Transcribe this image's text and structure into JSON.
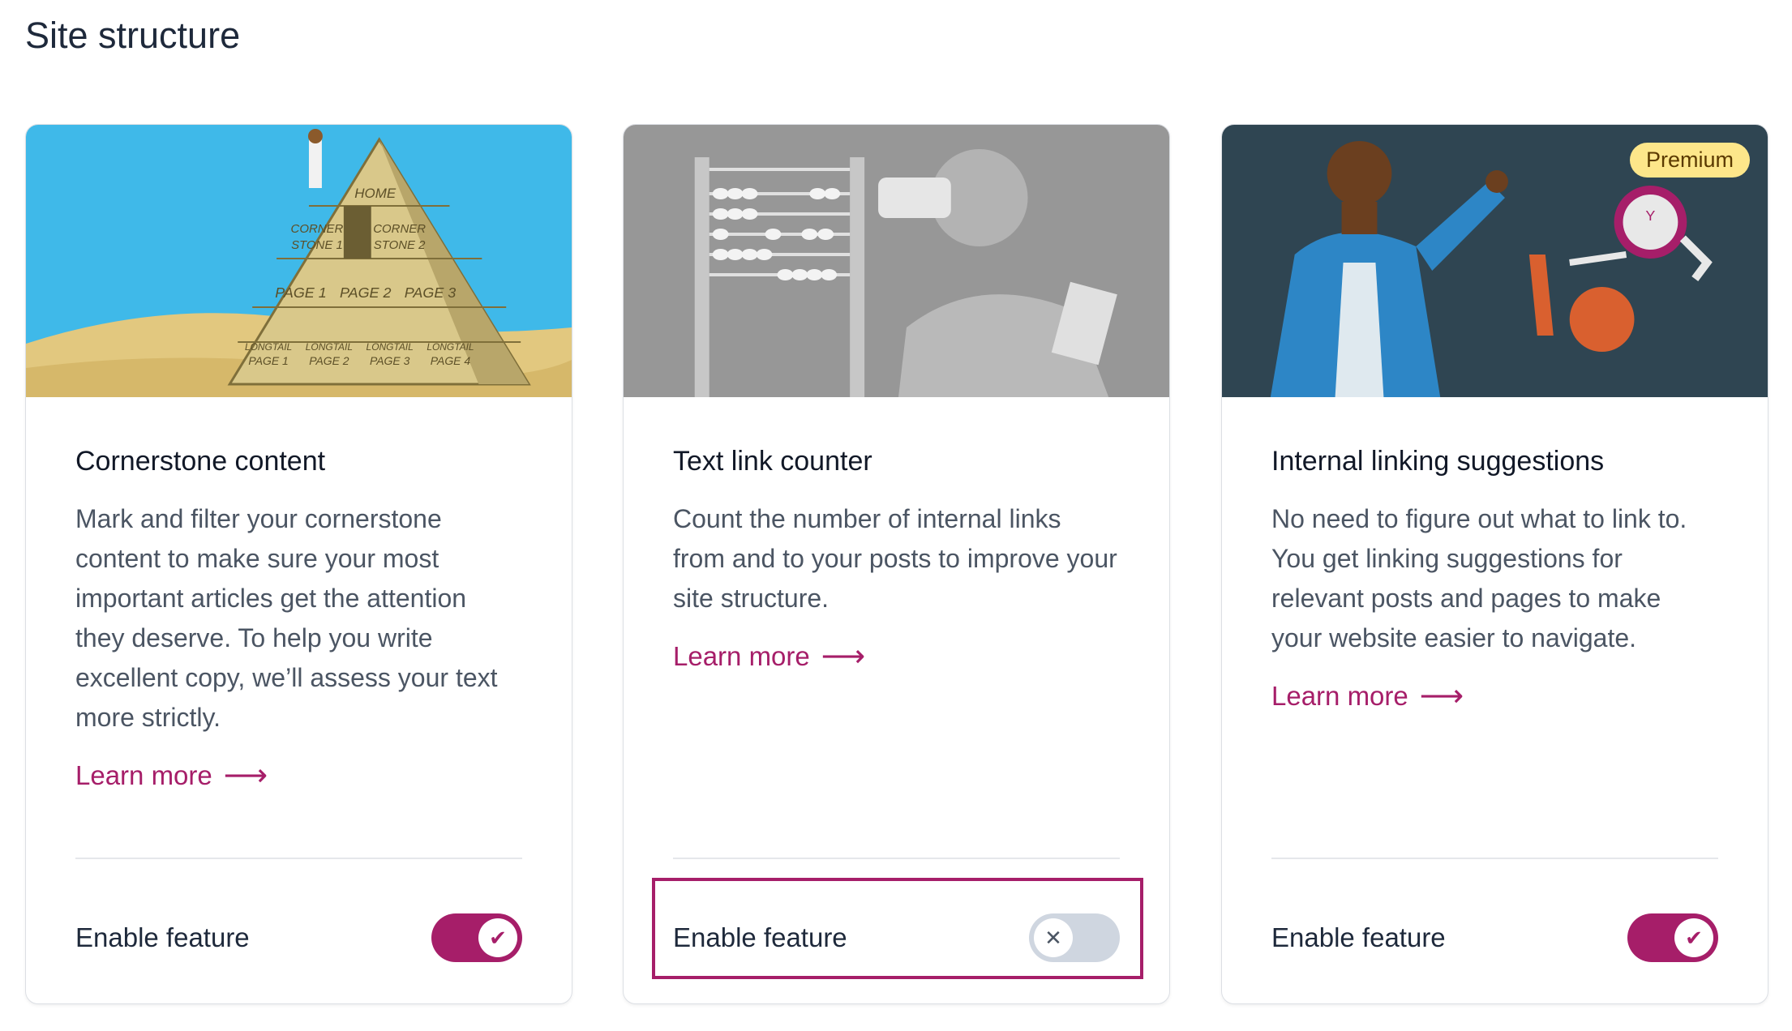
{
  "page": {
    "title": "Site structure"
  },
  "cards": [
    {
      "title": "Cornerstone content",
      "description": "Mark and filter your cornerstone content to make sure your most important articles get the attention they deserve. To help you write excellent copy, we’ll assess your text more strictly.",
      "learn_more": "Learn more",
      "toggle_label": "Enable feature",
      "enabled": true,
      "image_text": {
        "home": "HOME",
        "cs1a": "CORNER",
        "cs1b": "STONE 1",
        "cs2a": "CORNER",
        "cs2b": "STONE 2",
        "p1": "PAGE 1",
        "p2": "PAGE 2",
        "p3": "PAGE 3",
        "lt": "LONGTAIL",
        "lp1": "PAGE 1",
        "lp2": "PAGE 2",
        "lp3": "PAGE 3",
        "lp4": "PAGE 4"
      }
    },
    {
      "title": "Text link counter",
      "description": "Count the number of internal links from and to your posts to improve your site structure.",
      "learn_more": "Learn more",
      "toggle_label": "Enable feature",
      "enabled": false
    },
    {
      "title": "Internal linking suggestions",
      "description": "No need to figure out what to link to. You get linking suggestions for relevant posts and pages to make your website easier to navigate.",
      "learn_more": "Learn more",
      "toggle_label": "Enable feature",
      "enabled": true,
      "badge": "Premium"
    }
  ],
  "icons": {
    "arrow": "⟶",
    "check": "✔",
    "cross": "✕"
  },
  "colors": {
    "accent": "#a61e69",
    "toggle_off": "#cfd6e0",
    "premium_badge": "#fde68a"
  }
}
